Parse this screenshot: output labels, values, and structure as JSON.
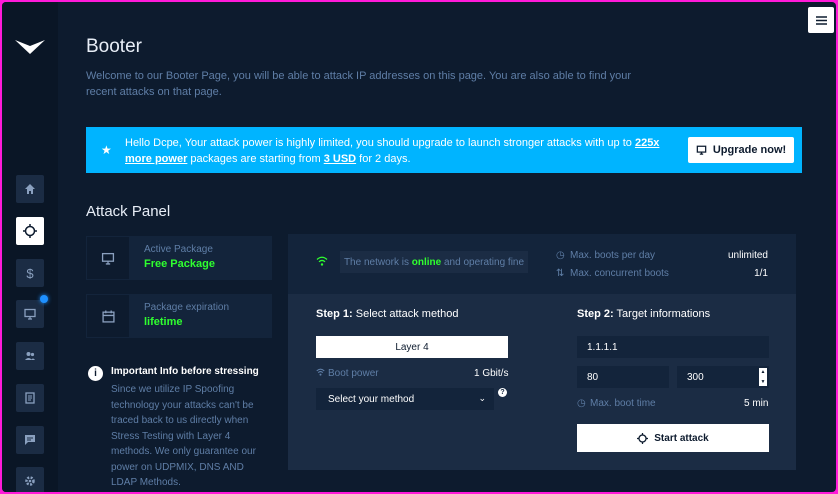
{
  "page": {
    "title": "Booter",
    "intro": "Welcome to our Booter Page, you will be able to attack IP addresses on this page. You are also able to find your recent attacks on that page."
  },
  "alert": {
    "text_1": "Hello Dcpe, Your attack power is highly limited, you should upgrade to launch stronger attacks with up to ",
    "link_1": "225x more power",
    "text_2": " packages are starting from ",
    "link_2": "3 USD",
    "text_3": " for 2 days.",
    "upgrade_label": "Upgrade now!"
  },
  "section": {
    "title": "Attack Panel"
  },
  "package": {
    "active_label": "Active Package",
    "active_value": "Free Package",
    "expiration_label": "Package expiration",
    "expiration_value": "lifetime"
  },
  "info": {
    "title": "Important Info before stressing",
    "text": "Since we utilize IP Spoofing technology your attacks can't be traced back to us directly when Stress Testing with Layer 4 methods. We only guarantee our power on UDPMIX, DNS AND LDAP Methods."
  },
  "network": {
    "prefix": "The network is ",
    "status": "online",
    "suffix": " and operating fine"
  },
  "stats": {
    "max_boots_label": "Max. boots per day",
    "max_boots_value": "unlimited",
    "max_concurrent_label": "Max. concurrent boots",
    "max_concurrent_value": "1/1"
  },
  "step1": {
    "prefix": "Step 1:",
    "label": " Select attack method",
    "layer_label": "Layer 4",
    "boot_power_label": "Boot power",
    "boot_power_value": "1 Gbit/s",
    "method_placeholder": "Select your method"
  },
  "step2": {
    "prefix": "Step 2:",
    "label": " Target informations",
    "ip": "1.1.1.1",
    "port": "80",
    "time": "300",
    "max_boot_label": "Max. boot time",
    "max_boot_value": "5 min",
    "start_label": "Start attack"
  },
  "icons": [
    "logo-icon",
    "home-icon",
    "crosshair-icon",
    "dollar-icon",
    "monitor-icon",
    "users-icon",
    "book-icon",
    "chat-icon",
    "gear-icon",
    "menu-icon",
    "star-icon",
    "wifi-icon",
    "calendar-icon",
    "info-icon",
    "clock-icon",
    "sort-icon",
    "chevron-down-icon",
    "help-icon"
  ],
  "colors": {
    "accent": "#00b4ff",
    "success": "#2fff2f",
    "background": "#0d1b2e",
    "frame": "#ff1ad9"
  }
}
